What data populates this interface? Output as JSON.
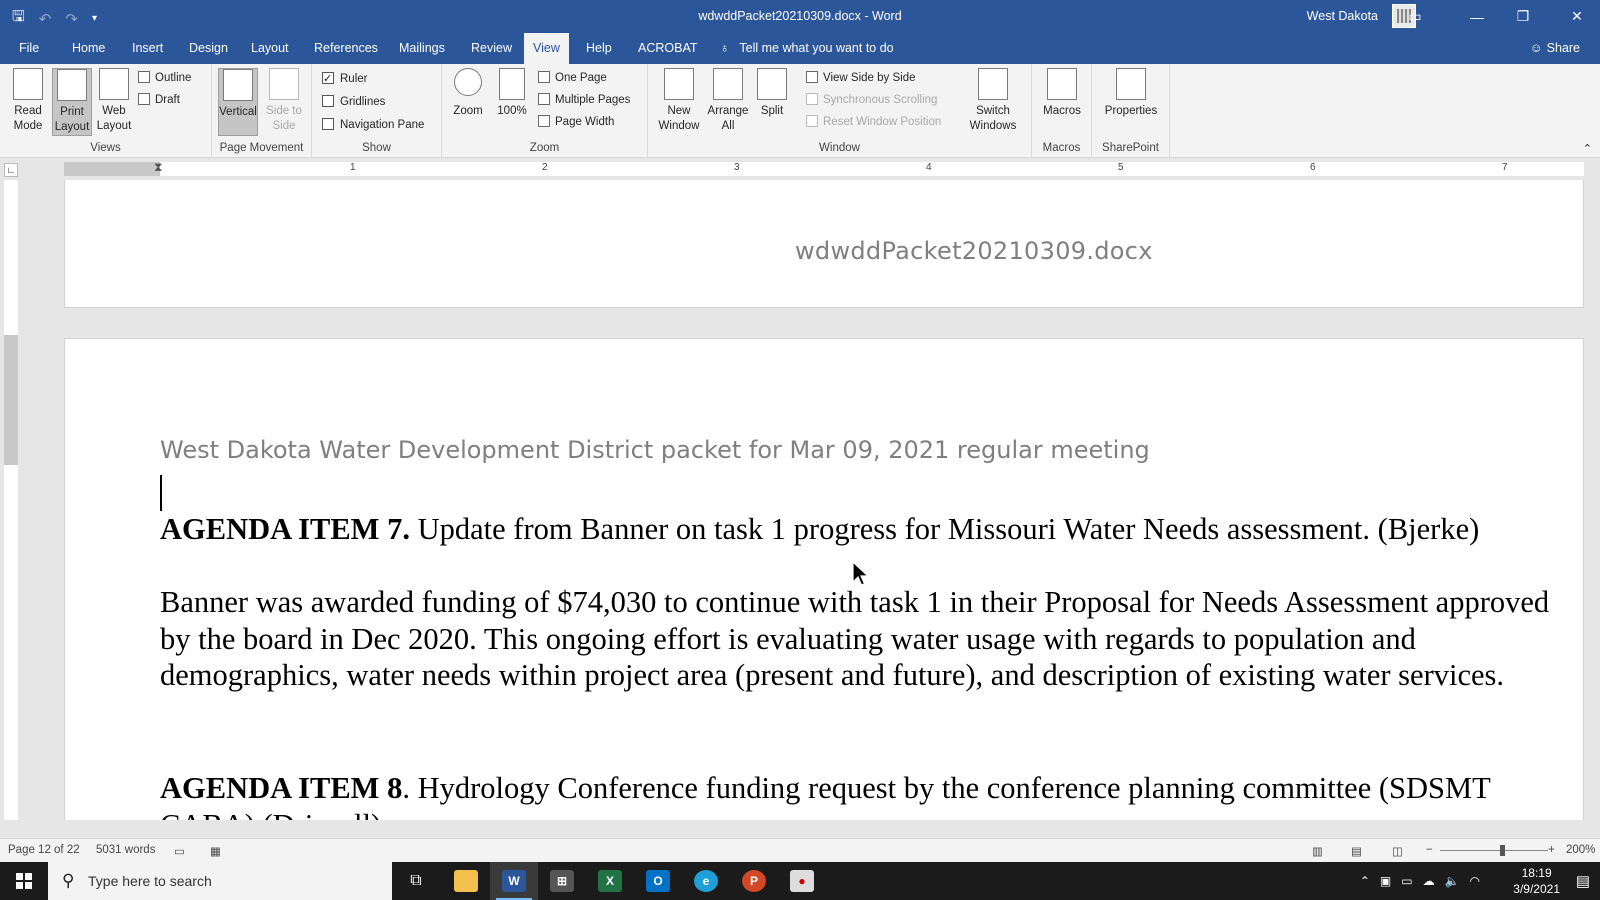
{
  "titlebar": {
    "doc_title": "wdwddPacket20210309.docx  -  Word",
    "user_name": "West Dakota",
    "qat": [
      "save-icon",
      "undo-icon",
      "redo-icon",
      "customize-icon"
    ],
    "window_controls": {
      "ribbon_options": "▭",
      "minimize": "—",
      "restore": "❐",
      "close": "✕"
    }
  },
  "tabs": [
    {
      "label": "File",
      "active": false
    },
    {
      "label": "Home",
      "active": false
    },
    {
      "label": "Insert",
      "active": false
    },
    {
      "label": "Design",
      "active": false
    },
    {
      "label": "Layout",
      "active": false
    },
    {
      "label": "References",
      "active": false
    },
    {
      "label": "Mailings",
      "active": false
    },
    {
      "label": "Review",
      "active": false
    },
    {
      "label": "View",
      "active": true
    },
    {
      "label": "Help",
      "active": false
    },
    {
      "label": "ACROBAT",
      "active": false
    }
  ],
  "tellme": "Tell me what you want to do",
  "share": "Share",
  "ribbon": {
    "views": {
      "label": "Views",
      "read_mode": "Read Mode",
      "print_layout": "Print Layout",
      "web_layout": "Web Layout",
      "outline": "Outline",
      "draft": "Draft"
    },
    "page_movement": {
      "label": "Page Movement",
      "vertical": "Vertical",
      "side_to_side": "Side to Side"
    },
    "show": {
      "label": "Show",
      "ruler": "Ruler",
      "gridlines": "Gridlines",
      "navigation_pane": "Navigation Pane",
      "ruler_checked": true
    },
    "zoom": {
      "label": "Zoom",
      "zoom": "Zoom",
      "hundred": "100%",
      "one_page": "One Page",
      "multiple_pages": "Multiple Pages",
      "page_width": "Page Width"
    },
    "window": {
      "label": "Window",
      "new_window": "New Window",
      "arrange_all": "Arrange All",
      "split": "Split",
      "view_side_by_side": "View Side by Side",
      "synchronous_scrolling": "Synchronous Scrolling",
      "reset_window_position": "Reset Window Position",
      "switch_windows": "Switch Windows"
    },
    "macros": {
      "label": "Macros",
      "macros": "Macros"
    },
    "sharepoint": {
      "label": "SharePoint",
      "properties": "Properties"
    }
  },
  "ruler": {
    "numbers": [
      "1",
      "2",
      "3",
      "4",
      "5",
      "6",
      "7"
    ]
  },
  "document": {
    "header_filename": "wdwddPacket20210309.docx",
    "heading": "West Dakota Water Development District packet for Mar 09, 2021 regular meeting",
    "item7_label": "AGENDA ITEM 7.",
    "item7_text": " Update from Banner on task 1 progress for Missouri Water Needs assessment. (Bjerke)",
    "paragraph": "Banner was awarded funding of $74,030 to continue with task 1 in their Proposal for Needs Assessment approved by the board in Dec 2020. This ongoing effort is evaluating water usage with regards to population and demographics, water needs within project area (present and future), and description of existing water services.",
    "item8_label": "AGENDA ITEM 8",
    "item8_text": ". Hydrology Conference funding request by the conference planning committee (SDSMT",
    "item8_cutoff": "CABA)  (Driscoll)"
  },
  "statusbar": {
    "page": "Page 12 of 22",
    "words": "5031 words",
    "zoom_minus": "−",
    "zoom_plus": "+",
    "zoom_level": "200%"
  },
  "taskbar": {
    "search_placeholder": "Type here to search",
    "time": "18:19",
    "date": "3/9/2021",
    "apps": [
      "task-view",
      "file-explorer",
      "word",
      "store",
      "excel",
      "outlook",
      "edge",
      "powerpoint",
      "recorder"
    ]
  }
}
